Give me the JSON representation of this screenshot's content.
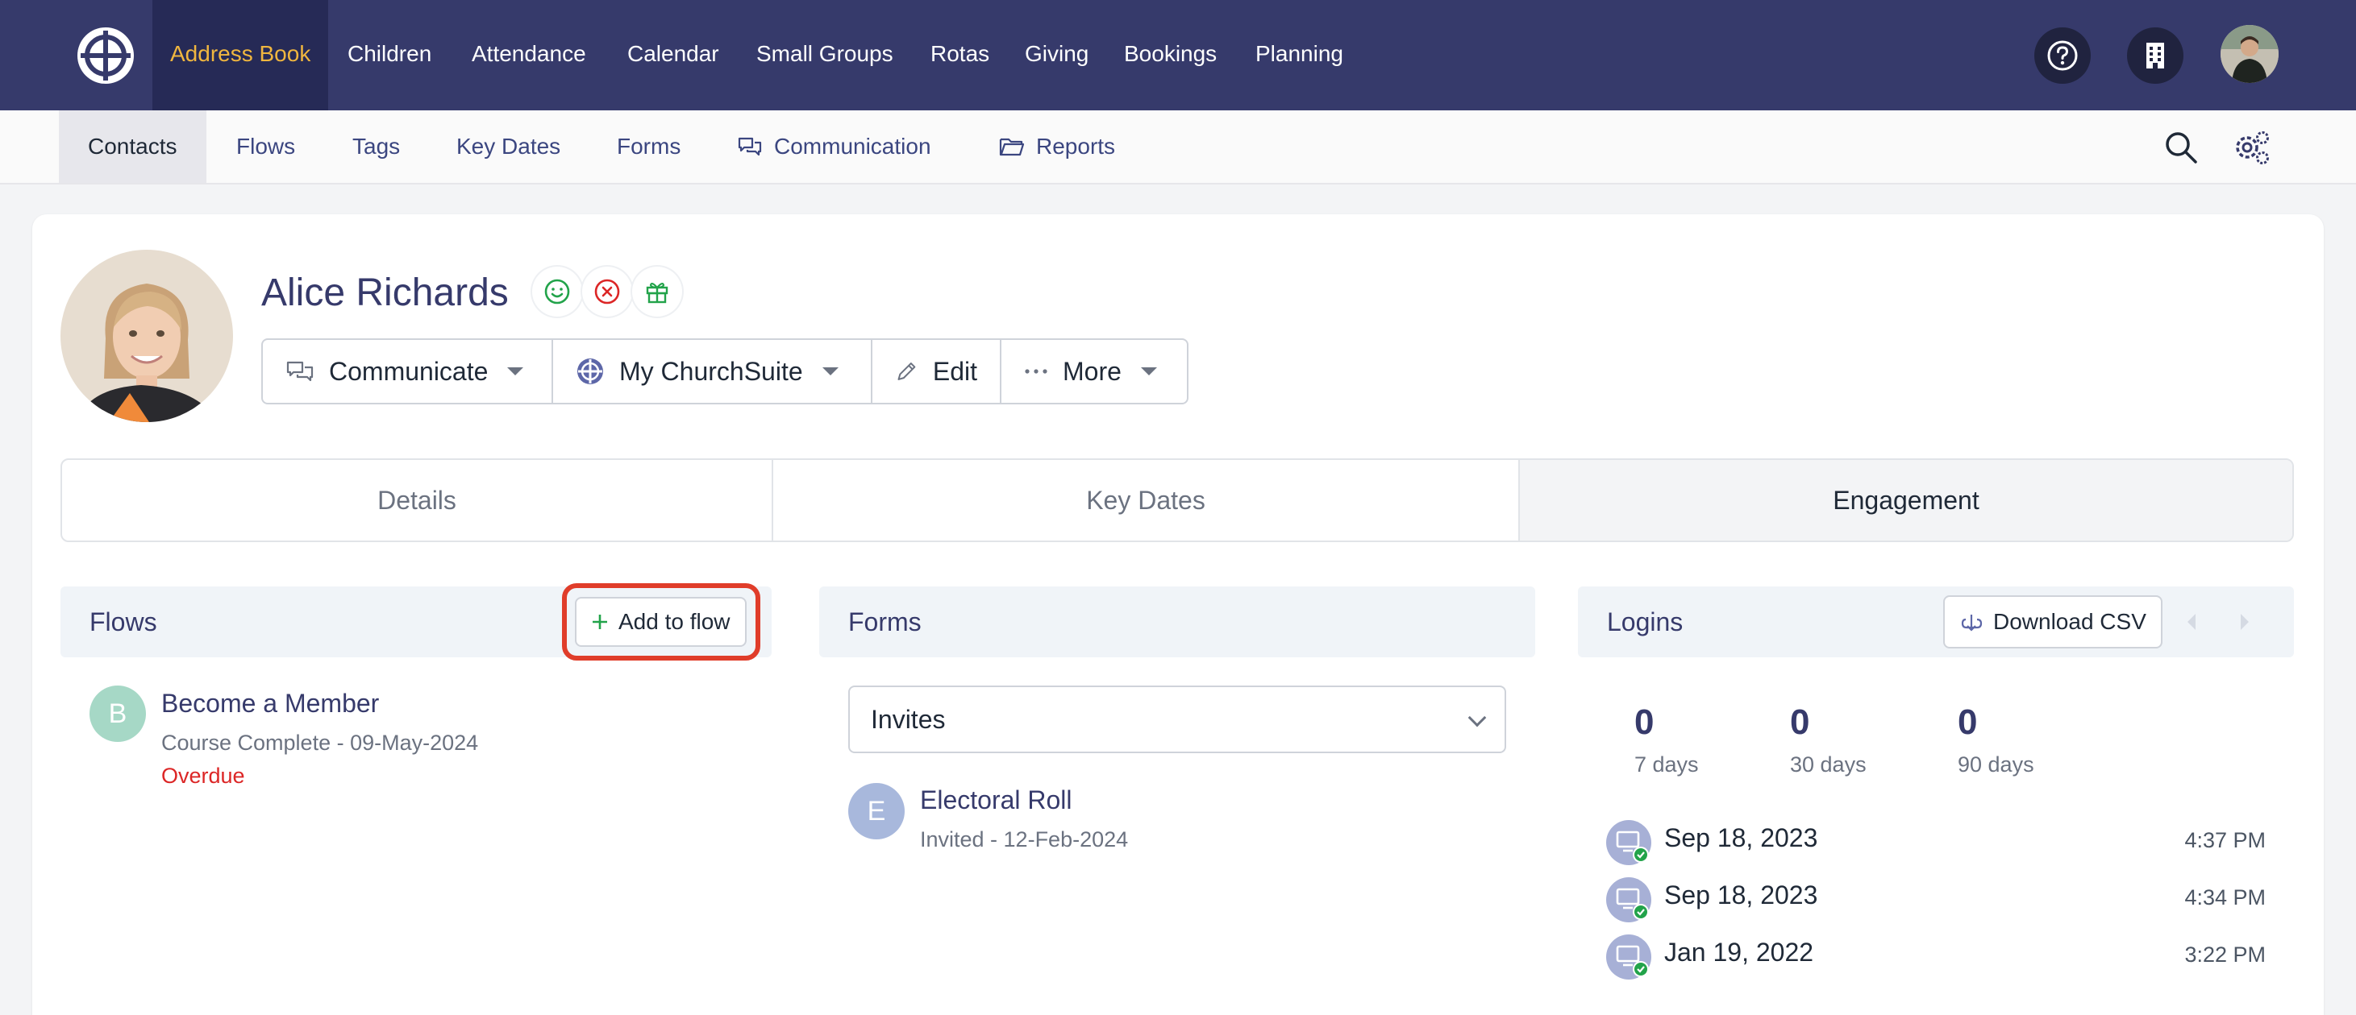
{
  "top_nav": {
    "items": [
      {
        "label": "Address Book",
        "active": true
      },
      {
        "label": "Children"
      },
      {
        "label": "Attendance"
      },
      {
        "label": "Calendar"
      },
      {
        "label": "Small Groups"
      },
      {
        "label": "Rotas"
      },
      {
        "label": "Giving"
      },
      {
        "label": "Bookings"
      },
      {
        "label": "Planning"
      }
    ],
    "icons": [
      "help-icon",
      "building-icon",
      "user-avatar"
    ]
  },
  "sub_nav": {
    "items": [
      {
        "label": "Contacts",
        "active": true
      },
      {
        "label": "Flows"
      },
      {
        "label": "Tags"
      },
      {
        "label": "Key Dates"
      },
      {
        "label": "Forms"
      },
      {
        "label": "Communication",
        "icon": "chat-icon"
      },
      {
        "label": "Reports",
        "icon": "folder-icon"
      }
    ]
  },
  "contact": {
    "name": "Alice Richards",
    "status_icons": [
      "smile-icon",
      "x-circle-icon",
      "gift-icon"
    ]
  },
  "actions": [
    {
      "label": "Communicate",
      "icon": "chat-icon",
      "dropdown": true
    },
    {
      "label": "My ChurchSuite",
      "icon": "churchsuite-icon",
      "dropdown": true
    },
    {
      "label": "Edit",
      "icon": "pencil-icon",
      "dropdown": false
    },
    {
      "label": "More",
      "icon": "ellipsis-icon",
      "dropdown": true
    }
  ],
  "tabs": [
    {
      "label": "Details"
    },
    {
      "label": "Key Dates"
    },
    {
      "label": "Engagement",
      "active": true
    }
  ],
  "flows": {
    "title": "Flows",
    "add_button": "Add to flow",
    "items": [
      {
        "initial": "B",
        "title": "Become a Member",
        "status": "Course Complete - 09-May-2024",
        "flag": "Overdue"
      }
    ]
  },
  "forms": {
    "title": "Forms",
    "select_value": "Invites",
    "items": [
      {
        "initial": "E",
        "title": "Electoral Roll",
        "status": "Invited - 12-Feb-2024"
      }
    ]
  },
  "logins": {
    "title": "Logins",
    "download_button": "Download CSV",
    "stats": [
      {
        "value": "0",
        "label": "7 days"
      },
      {
        "value": "0",
        "label": "30 days"
      },
      {
        "value": "0",
        "label": "90 days"
      }
    ],
    "entries": [
      {
        "date": "Sep 18, 2023",
        "time": "4:37 PM"
      },
      {
        "date": "Sep 18, 2023",
        "time": "4:34 PM"
      },
      {
        "date": "Jan 19, 2022",
        "time": "3:22 PM"
      }
    ]
  },
  "colors": {
    "nav_bg": "#363a6b",
    "nav_active": "#f0b63f",
    "highlight": "#e03d2a",
    "overdue": "#dc2626"
  }
}
